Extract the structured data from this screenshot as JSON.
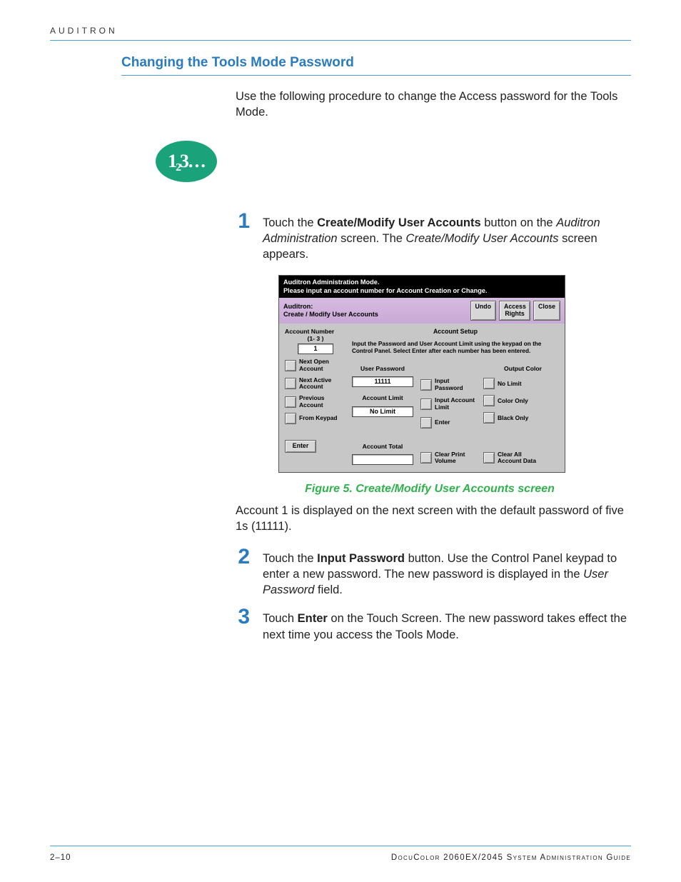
{
  "chapter": "AUDITRON",
  "section_title": "Changing the Tools Mode Password",
  "intro": "Use the following procedure to change the Access password for the Tools Mode.",
  "badge": "1₂3…",
  "steps": {
    "s1": {
      "num": "1",
      "parts": {
        "lead": "Touch the ",
        "bold1": "Create/Modify User Accounts",
        "mid1": " button on the ",
        "it1": "Auditron Administration",
        "mid2": " screen. The ",
        "it2": "Create/Modify User Accounts",
        "tail": " screen appears."
      }
    },
    "s2": {
      "num": "2",
      "parts": {
        "lead": "Touch the ",
        "bold1": "Input Password",
        "mid1": " button. Use the Control Panel keypad to enter a new password. The new password is displayed in the ",
        "it1": "User Password",
        "tail": " field."
      }
    },
    "s3": {
      "num": "3",
      "parts": {
        "lead": "Touch ",
        "bold1": "Enter",
        "tail": " on the Touch Screen. The new password takes effect the next time you access the Tools Mode."
      }
    }
  },
  "figure_caption": "Figure 5. Create/Modify User Accounts screen",
  "after_figure": "Account 1 is displayed on the next screen with the default password of five 1s (11111).",
  "mock": {
    "black_l1": "Auditron Administration Mode.",
    "black_l2": "Please input an account number for Account Creation or Change.",
    "title_l1": "Auditron:",
    "title_l2": "Create / Modify User Accounts",
    "undo": "Undo",
    "access_rights": "Access Rights",
    "close": "Close",
    "account_number_label": "Account Number",
    "account_number_range": "(1-    3 )",
    "account_number_value": "1",
    "next_open": "Next Open Account",
    "next_active": "Next Active Account",
    "previous": "Previous Account",
    "from_keypad": "From Keypad",
    "enter_left": "Enter",
    "account_setup": "Account Setup",
    "instr": "Input the Password and User Account Limit using the keypad on the Control Panel. Select Enter after each number has been entered.",
    "user_password_label": "User Password",
    "user_password_value": "11111",
    "account_limit_label": "Account Limit",
    "account_limit_value": "No Limit",
    "input_password": "Input Password",
    "input_account_limit": "Input Account Limit",
    "enter_center": "Enter",
    "output_color": "Output Color",
    "no_limit": "No Limit",
    "color_only": "Color Only",
    "black_only": "Black Only",
    "account_total_label": "Account Total",
    "clear_print_volume": "Clear Print Volume",
    "clear_all_account_data": "Clear All Account Data"
  },
  "footer": {
    "page": "2–10",
    "book": "DocuColor 2060EX/2045 System Administration Guide"
  }
}
